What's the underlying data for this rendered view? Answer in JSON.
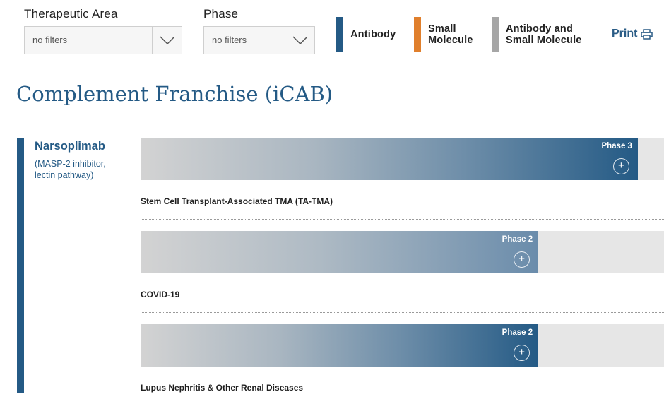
{
  "filters": {
    "therapeutic_area": {
      "label": "Therapeutic Area",
      "value": "no filters"
    },
    "phase": {
      "label": "Phase",
      "value": "no filters"
    }
  },
  "legend": [
    {
      "label": "Antibody",
      "color": "#245a85"
    },
    {
      "label": "Small\nMolecule",
      "color": "#e07f2c"
    },
    {
      "label": "Antibody and\nSmall Molecule",
      "color": "#a6a6a6"
    }
  ],
  "print_label": "Print",
  "page_title": "Complement Franchise (iCAB)",
  "drug": {
    "name": "Narsoplimab",
    "description": "(MASP-2 inhibitor, lectin pathway)",
    "color": "#245a85"
  },
  "programs": [
    {
      "phase": "Phase 3",
      "indication": "Stem Cell Transplant-Associated TMA (TA-TMA)",
      "progress": 0.95,
      "fill_gradient": "light-to-dark"
    },
    {
      "phase": "Phase 2",
      "indication": "COVID-19",
      "progress": 0.76,
      "fill_gradient": "light-to-mid"
    },
    {
      "phase": "Phase 2",
      "indication": "Lupus Nephritis & Other Renal Diseases",
      "progress": 0.76,
      "fill_gradient": "light-to-dark"
    }
  ]
}
